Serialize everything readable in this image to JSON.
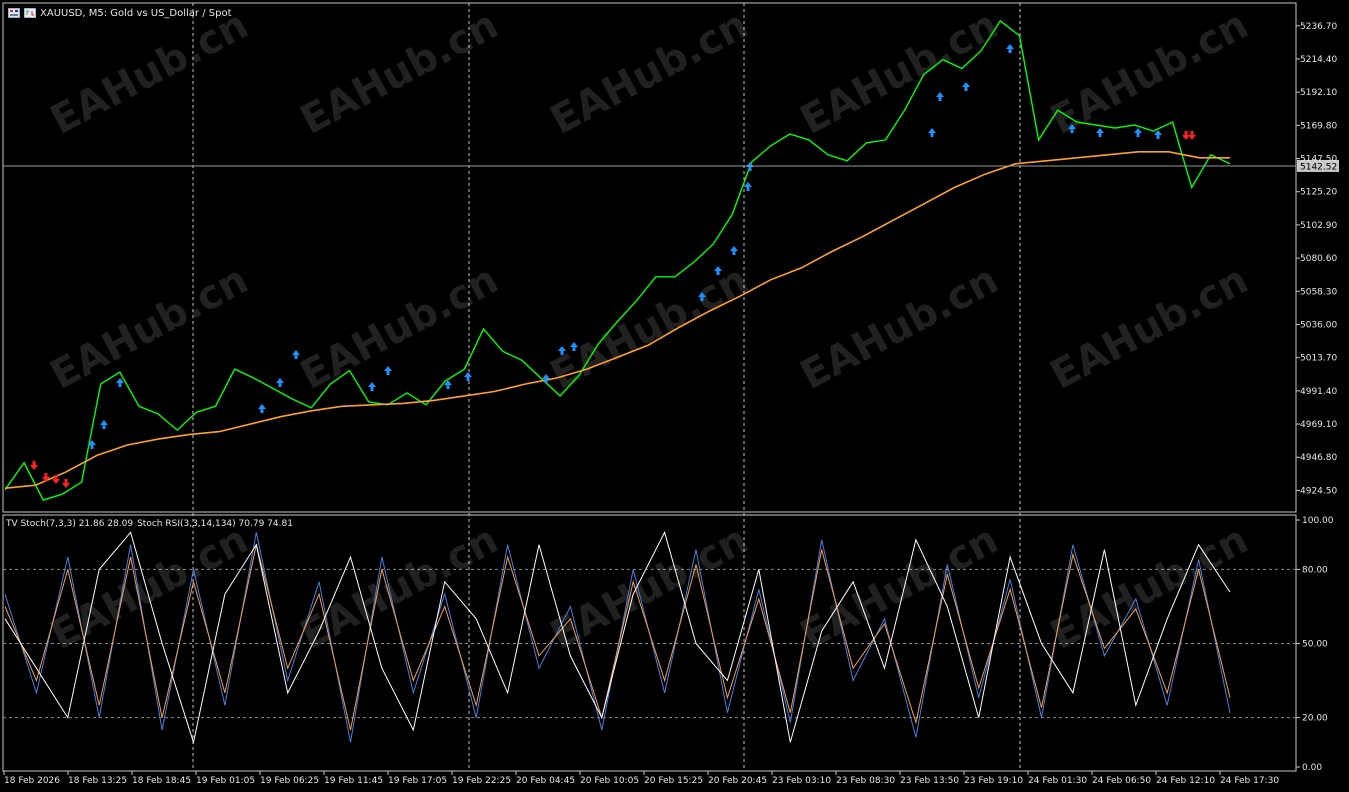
{
  "header": {
    "symbol_label": "XAUUSD, M5:  Gold vs US_Dollar / Spot"
  },
  "indicator_header": {
    "stoch_label": "TV Stoch(7,3,3) 21.86 28.09",
    "stoch_rsi_label": "Stoch RSI(3,3,14,134) 70.79 74.81"
  },
  "watermark": "EAHub.cn",
  "current_price_label": "5142.52",
  "colors": {
    "background": "#000000",
    "price_line": "#00ff00",
    "ma_line": "#ffa030",
    "buy_arrow": "#1e90ff",
    "sell_arrow": "#ff2020",
    "stoch_main": "#4a7fdc",
    "stoch_signal": "#f0a050",
    "stoch_rsi": "#ffffff",
    "grid": "#c8c8c8",
    "axis_text": "#e6e6e6",
    "current_price_box": "#c8c8c8"
  },
  "chart_data": [
    {
      "type": "line",
      "title": "XAUUSD, M5:  Gold vs US_Dollar / Spot",
      "ylim": [
        4910,
        5252
      ],
      "yticks": [
        "5236.70",
        "5214.40",
        "5192.10",
        "5169.80",
        "5147.50",
        "5125.20",
        "5102.90",
        "5080.60",
        "5058.30",
        "5036.00",
        "5013.70",
        "4991.40",
        "4969.10",
        "4946.80",
        "4924.50"
      ],
      "xtick_labels": [
        "18 Feb 2026",
        "18 Feb 13:25",
        "18 Feb 18:45",
        "19 Feb 01:05",
        "19 Feb 06:25",
        "19 Feb 11:45",
        "19 Feb 17:05",
        "19 Feb 22:25",
        "20 Feb 04:45",
        "20 Feb 10:05",
        "20 Feb 15:25",
        "20 Feb 20:45",
        "23 Feb 03:10",
        "23 Feb 08:30",
        "23 Feb 13:50",
        "23 Feb 19:10",
        "24 Feb 01:30",
        "24 Feb 06:50",
        "24 Feb 12:10",
        "24 Feb 17:30"
      ],
      "current_price": 5142.52,
      "series": [
        {
          "values": [
            4925,
            4943,
            4918,
            4922,
            4930,
            4996,
            5004,
            4981,
            4976,
            4965,
            4977,
            4981,
            5006,
            5000,
            4993,
            4986,
            4980,
            4996,
            5005,
            4984,
            4982,
            4990,
            4982,
            4998,
            5006,
            5033,
            5018,
            5012,
            5000,
            4988,
            5002,
            5023,
            5038,
            5052,
            5068,
            5068,
            5078,
            5090,
            5110,
            5145,
            5156,
            5164,
            5160,
            5150,
            5146,
            5158,
            5160,
            5180,
            5204,
            5214,
            5208,
            5220,
            5240,
            5230,
            5160,
            5180,
            5172,
            5170,
            5168,
            5170,
            5166,
            5172,
            5128,
            5150,
            5144
          ]
        },
        {
          "values": [
            4926,
            4928,
            4937,
            4948,
            4955,
            4959,
            4962,
            4964,
            4969,
            4974,
            4978,
            4981,
            4982,
            4983,
            4985,
            4988,
            4991,
            4996,
            5000,
            5006,
            5014,
            5022,
            5034,
            5045,
            5055,
            5066,
            5074,
            5085,
            5095,
            5106,
            5117,
            5128,
            5137,
            5144,
            5146,
            5148,
            5150,
            5152,
            5152,
            5148,
            5148
          ]
        }
      ]
    },
    {
      "type": "line",
      "title": "TV Stoch(7,3,3) 21.86 28.09 Stoch RSI(3,3,14,134) 70.79 74.81",
      "ylim": [
        0,
        100
      ],
      "yticks": [
        "100.00",
        "80.00",
        "50.00",
        "20.00",
        "0.00"
      ],
      "series": [
        {
          "values": [
            70,
            30,
            85,
            20,
            90,
            15,
            80,
            25,
            95,
            35,
            75,
            10,
            85,
            30,
            70,
            20,
            90,
            40,
            65,
            15,
            80,
            30,
            88,
            22,
            72,
            18,
            92,
            35,
            60,
            12,
            82,
            28,
            76,
            20,
            90,
            45,
            68,
            25,
            84,
            21.86
          ]
        },
        {
          "values": [
            65,
            35,
            80,
            25,
            85,
            20,
            75,
            30,
            90,
            40,
            70,
            15,
            80,
            35,
            65,
            25,
            85,
            45,
            60,
            20,
            75,
            35,
            82,
            28,
            68,
            22,
            88,
            40,
            58,
            18,
            78,
            32,
            72,
            24,
            86,
            48,
            64,
            30,
            80,
            28.09
          ]
        },
        {
          "values": [
            60,
            40,
            20,
            80,
            95,
            50,
            10,
            70,
            90,
            30,
            55,
            85,
            40,
            15,
            75,
            60,
            30,
            90,
            45,
            20,
            70,
            95,
            50,
            35,
            80,
            10,
            55,
            75,
            40,
            92,
            65,
            20,
            85,
            50,
            30,
            88,
            25,
            60,
            90,
            70.79
          ]
        }
      ]
    }
  ]
}
